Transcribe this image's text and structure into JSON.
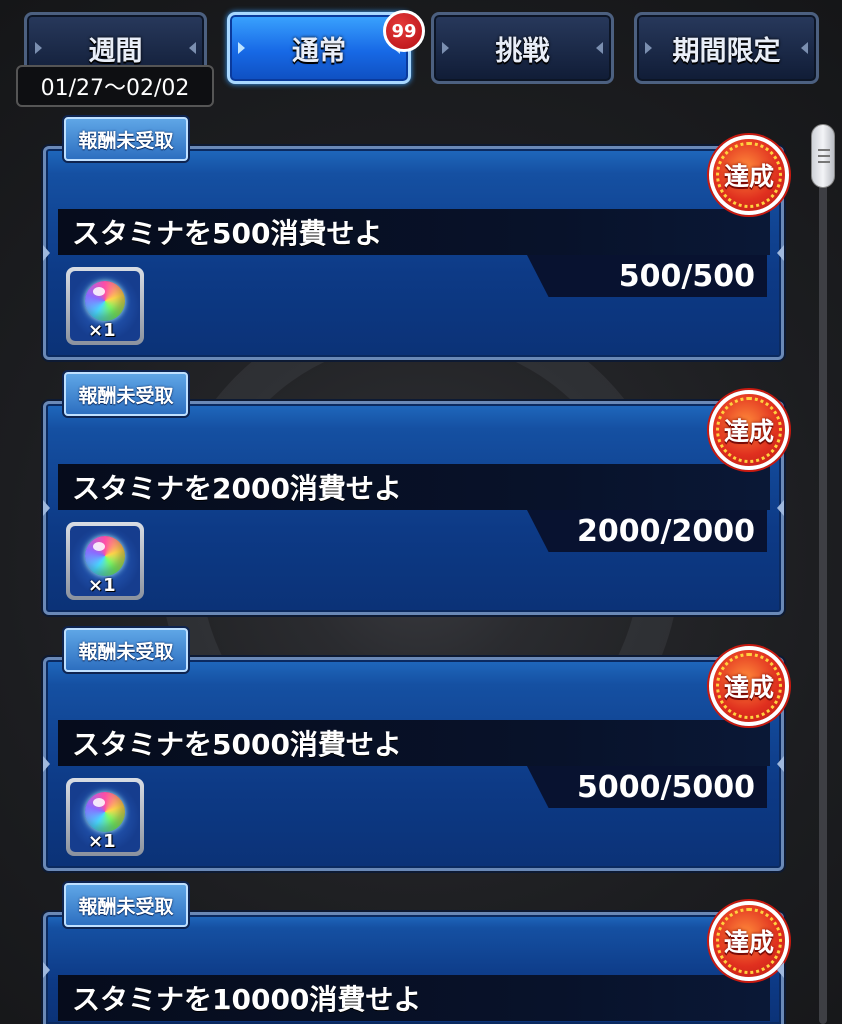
{
  "tabs": [
    {
      "label": "週間",
      "active": false
    },
    {
      "label": "通常",
      "active": true
    },
    {
      "label": "挑戦",
      "active": false
    },
    {
      "label": "期間限定",
      "active": false
    }
  ],
  "notification_count": "99",
  "date_range": "01/27〜02/02",
  "missions": [
    {
      "status_label": "報酬未受取",
      "title": "スタミナを500消費せよ",
      "progress": "500/500",
      "reward_qty": "×1",
      "reward_icon": "rainbow-orb-icon",
      "stamp": "達成"
    },
    {
      "status_label": "報酬未受取",
      "title": "スタミナを2000消費せよ",
      "progress": "2000/2000",
      "reward_qty": "×1",
      "reward_icon": "rainbow-orb-icon",
      "stamp": "達成"
    },
    {
      "status_label": "報酬未受取",
      "title": "スタミナを5000消費せよ",
      "progress": "5000/5000",
      "reward_qty": "×1",
      "reward_icon": "rainbow-orb-icon",
      "stamp": "達成"
    },
    {
      "status_label": "報酬未受取",
      "title": "スタミナを10000消費せよ",
      "stamp": "達成"
    }
  ],
  "colors": {
    "accent": "#1769e6",
    "card": "#0d3a86",
    "stamp": "#e0301f"
  }
}
